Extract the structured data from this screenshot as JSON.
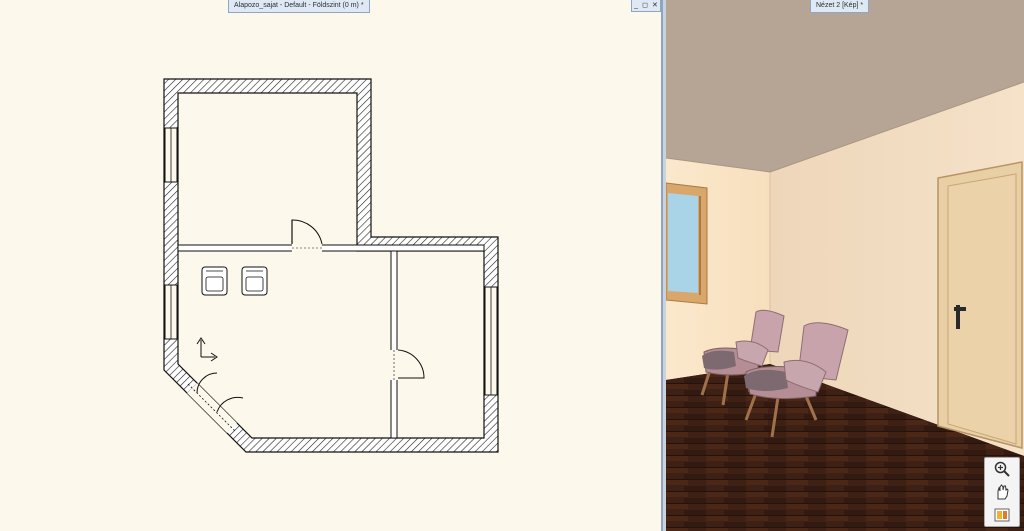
{
  "plan_window": {
    "title": "Alapozo_sajat - Default - Földszint (0 m) *",
    "controls": {
      "minimize": "_",
      "restore": "◻",
      "close": "✕"
    }
  },
  "view_window": {
    "title": "Nézet 2 [Kép] *"
  },
  "view_toolbar": {
    "zoom_icon": "zoom-icon",
    "pan_icon": "pan-hand-icon",
    "layers_icon": "layers-icon"
  },
  "colors": {
    "plan_background": "#fdf8ec",
    "wall_outline": "#111111",
    "ceiling": "#b6a594",
    "wall_light": "#f1d9bb",
    "floor": "#3a1e14",
    "chair_pink": "#c7a6ad"
  }
}
